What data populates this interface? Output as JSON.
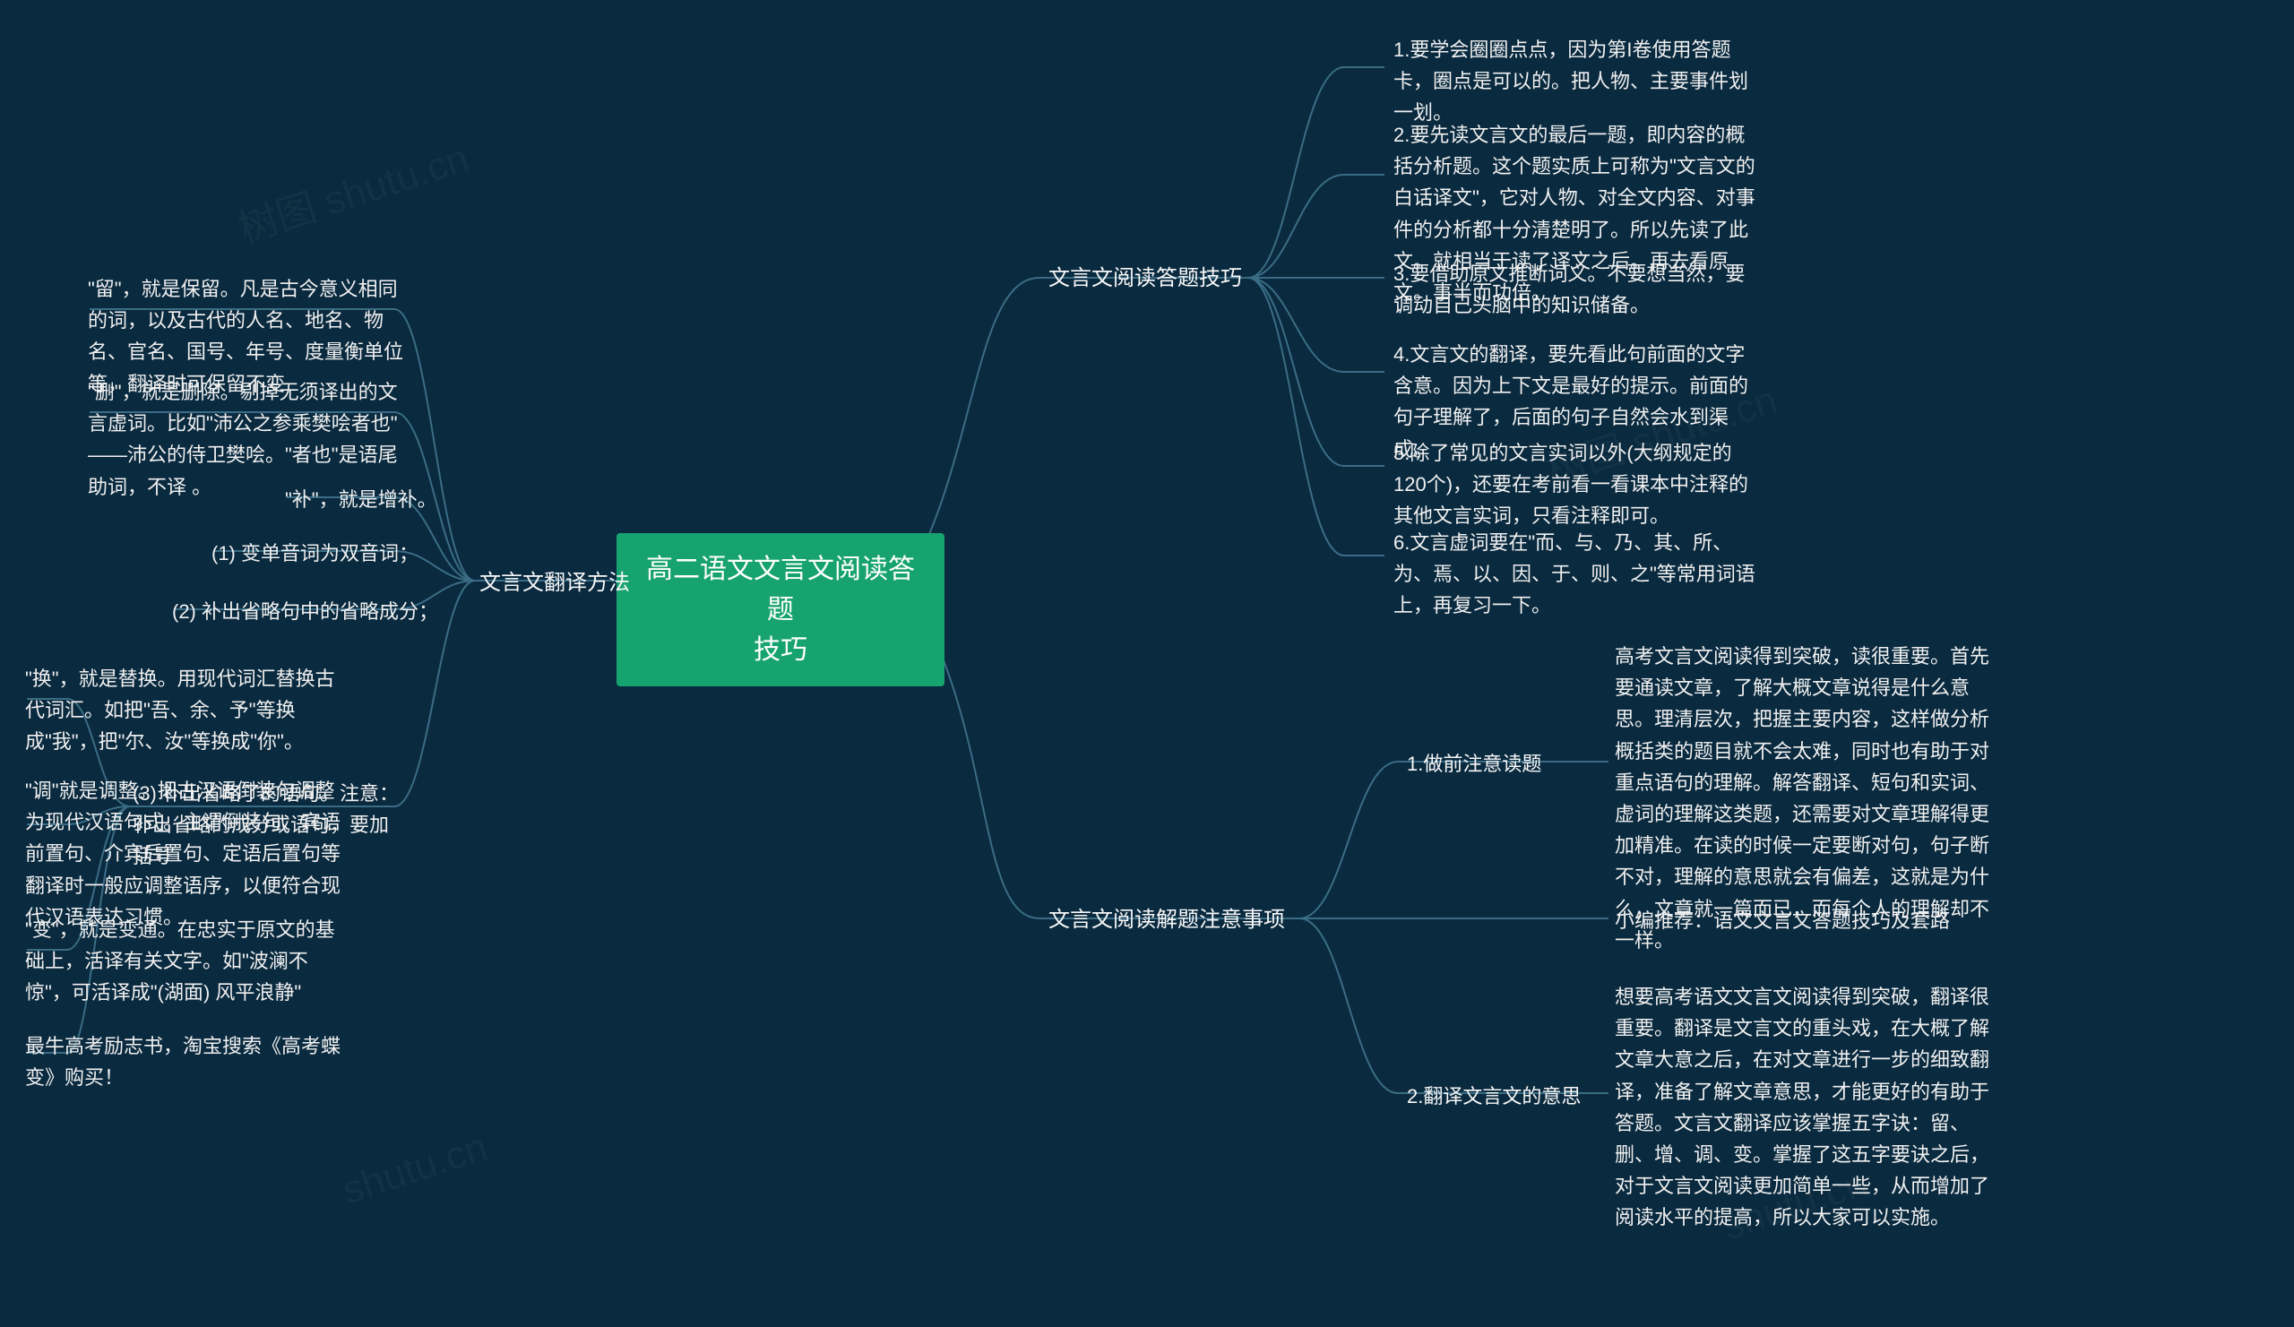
{
  "root": {
    "title_line1": "高二语文文言文阅读答题",
    "title_line2": "技巧"
  },
  "right": {
    "b1": {
      "label": "文言文阅读答题技巧",
      "items": [
        "1.要学会圈圈点点，因为第I卷使用答题卡，圈点是可以的。把人物、主要事件划一划。",
        "2.要先读文言文的最后一题，即内容的概括分析题。这个题实质上可称为\"文言文的白话译文\"，它对人物、对全文内容、对事件的分析都十分清楚明了。所以先读了此文。就相当于读了译文之后。再去看原文。事半而功倍。",
        "3.要借助原文推断词义。不要想当然，要调动自己头脑中的知识储备。",
        "4.文言文的翻译，要先看此句前面的文字含意。因为上下文是最好的提示。前面的句子理解了，后面的句子自然会水到渠成。",
        "5.除了常见的文言实词以外(大纲规定的120个)，还要在考前看一看课本中注释的其他文言实词，只看注释即可。",
        "6.文言虚词要在\"而、与、乃、其、所、为、焉、以、因、于、则、之\"等常用词语上，再复习一下。"
      ]
    },
    "b2": {
      "label": "文言文阅读解题注意事项",
      "items": [
        {
          "label": "1.做前注意读题",
          "text": "高考文言文阅读得到突破，读很重要。首先要通读文章，了解大概文章说得是什么意思。理清层次，把握主要内容，这样做分析概括类的题目就不会太难，同时也有助于对重点语句的理解。解答翻译、短句和实词、虚词的理解这类题，还需要对文章理解得更加精准。在读的时候一定要断对句，句子断不对，理解的意思就会有偏差，这就是为什么，文章就一篇而已，而每个人的理解却不一样。"
        },
        {
          "label": "",
          "text": "小编推荐：语文文言文答题技巧及套路"
        },
        {
          "label": "2.翻译文言文的意思",
          "text": "想要高考语文文言文阅读得到突破，翻译很重要。翻译是文言文的重头戏，在大概了解文章大意之后，在对文章进行一步的细致翻译，准备了解文章意思，才能更好的有助于答题。文言文翻译应该掌握五字诀：留、删、增、调、变。掌握了这五字要诀之后，对于文言文阅读更加简单一些，从而增加了阅读水平的提高，所以大家可以实施。"
        }
      ]
    }
  },
  "left": {
    "b1": {
      "label": "文言文翻译方法",
      "items": [
        "\"留\"，就是保留。凡是古今意义相同的词，以及古代的人名、地名、物名、官名、国号、年号、度量衡单位等，翻译时可保留不变",
        "\"删\"，就是删除。剔掉无须译出的文言虚词。比如\"沛公之参乘樊哙者也\" ——沛公的侍卫樊哙。\"者也\"是语尾助词，不译 。",
        "\"补\"，就是增补。",
        "(1)  变单音词为双音词；",
        "(2)  补出省略句中的省略成分；",
        {
          "label": "(3)  补出省略了的语句。注意：补出省略的成分或语句，要加括号",
          "children": [
            "\"换\"，就是替换。用现代词汇替换古代词汇。如把\"吾、余、予\"等换成\"我\"，把\"尔、汝\"等换成\"你\"。",
            "\"调\"就是调整。把古汉语倒装句调整为现代汉语句式。主谓倒装句、宾语前置句、介宾后置句、定语后置句等翻译时一般应调整语序，以便符合现代汉语表达习惯。",
            "\"变\"，就是变通。在忠实于原文的基础上，活译有关文字。如\"波澜不惊\"，可活译成\"(湖面)  风平浪静\"",
            "最牛高考励志书，淘宝搜索《高考蝶变》购买！"
          ]
        }
      ]
    }
  },
  "watermarks": [
    "树图 shutu.cn",
    "shutu.cn"
  ]
}
